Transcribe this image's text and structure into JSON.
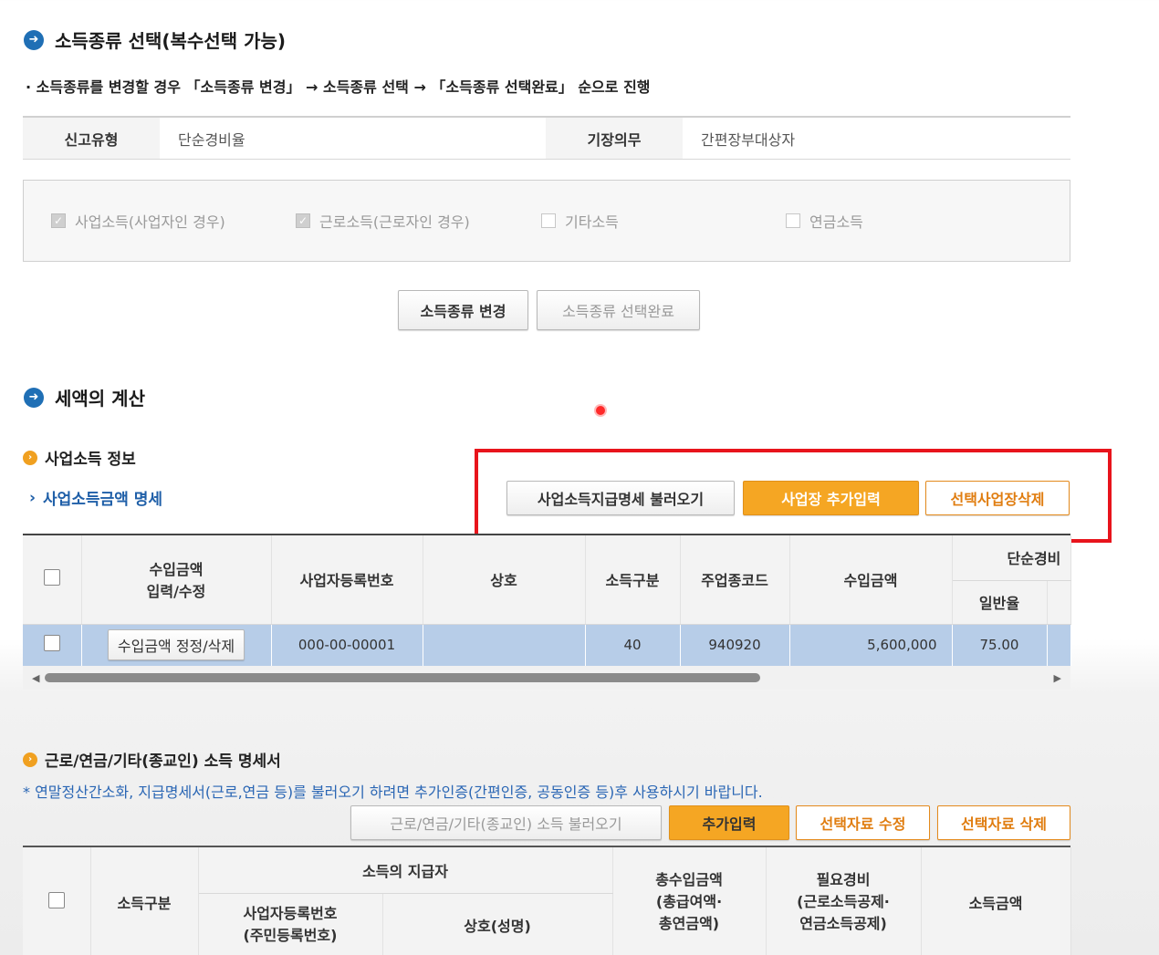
{
  "income_type": {
    "title": "소득종류 선택(복수선택 가능)",
    "note": "· 소득종류를 변경할 경우 「소득종류 변경」 → 소득종류 선택 → 「소득종류 선택완료」 순으로 진행",
    "report_type_label": "신고유형",
    "report_type_value": "단순경비율",
    "bookkeeping_label": "기장의무",
    "bookkeeping_value": "간편장부대상자",
    "checkboxes": [
      {
        "label": "사업소득(사업자인 경우)",
        "checked": true
      },
      {
        "label": "근로소득(근로자인 경우)",
        "checked": true
      },
      {
        "label": "기타소득",
        "checked": false
      },
      {
        "label": "연금소득",
        "checked": false
      }
    ],
    "change_button": "소득종류 변경",
    "complete_button": "소득종류 선택완료"
  },
  "tax_calc": {
    "title": "세액의 계산",
    "business_income": {
      "title": "사업소득 정보",
      "detail_link": "사업소득금액 명세",
      "load_button": "사업소득지급명세 불러오기",
      "add_button": "사업장 추가입력",
      "delete_button": "선택사업장삭제",
      "columns": {
        "revenue_edit": [
          "수입금액",
          "입력/수정"
        ],
        "biz_reg_no": "사업자등록번호",
        "company": "상호",
        "income_class": "소득구분",
        "industry_code": "주업종코드",
        "revenue": "수입금액",
        "simple_expense": "단순경비",
        "general": "일반율"
      },
      "rows": [
        {
          "edit_button": "수입금액 정정/삭제",
          "biz_reg_no": "000-00-00001",
          "company": "",
          "income_class": "40",
          "industry_code": "940920",
          "revenue": "5,600,000",
          "general_rate": "75.00"
        }
      ]
    },
    "other_income": {
      "title": "근로/연금/기타(종교인) 소득 명세서",
      "notice": "* 연말정산간소화, 지급명세서(근로,연금 등)를 불러오기 하려면 추가인증(간편인증, 공동인증 등)후 사용하시기 바랍니다.",
      "load_button": "근로/연금/기타(종교인) 소득 불러오기",
      "add_button": "추가입력",
      "edit_button": "선택자료 수정",
      "delete_button": "선택자료 삭제",
      "columns": {
        "income_class": "소득구분",
        "payer": "소득의 지급자",
        "biz_reg_no": [
          "사업자등록번호",
          "(주민등록번호)"
        ],
        "company": "상호(성명)",
        "total_income": [
          "총수입금액",
          "(총급여액·",
          "총연금액)"
        ],
        "expenses": [
          "필요경비",
          "(근로소득공제·",
          "연금소득공제)"
        ],
        "income_amount": "소득금액"
      }
    }
  },
  "colors": {
    "accent_blue": "#1f6fb5",
    "orange": "#f5a623",
    "highlight_red": "#e8141c",
    "selected_row": "#b7cde8"
  }
}
